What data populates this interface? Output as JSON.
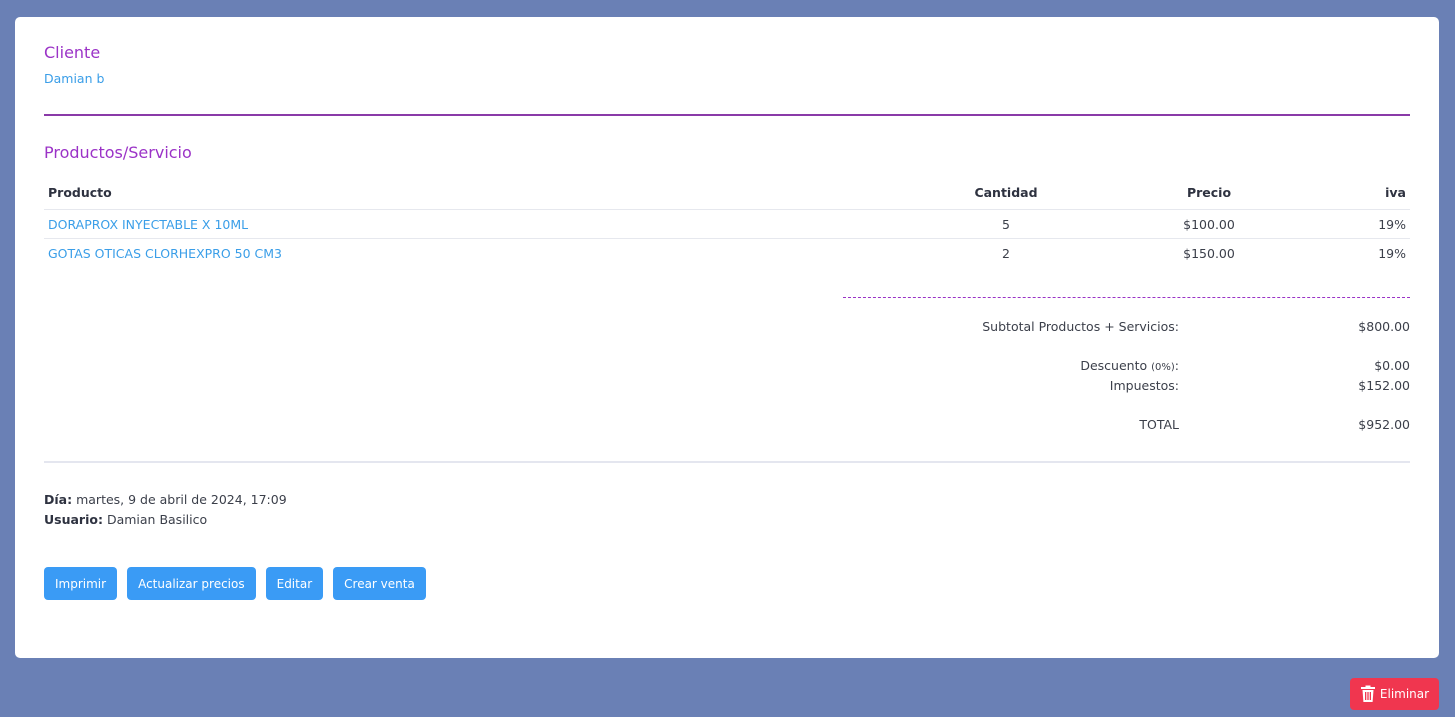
{
  "client": {
    "title": "Cliente",
    "name": "Damian b"
  },
  "products": {
    "title": "Productos/Servicio",
    "columns": [
      "Producto",
      "Cantidad",
      "Precio",
      "iva"
    ],
    "rows": [
      {
        "name": "DORAPROX INYECTABLE X 10ML",
        "qty": "5",
        "price": "$100.00",
        "iva": "19%"
      },
      {
        "name": "GOTAS OTICAS CLORHEXPRO 50 CM3",
        "qty": "2",
        "price": "$150.00",
        "iva": "19%"
      }
    ]
  },
  "summary": {
    "subtotal_label": "Subtotal Productos + Servicios:",
    "subtotal_value": "$800.00",
    "discount_label": "Descuento",
    "discount_pct": "(0%)",
    "discount_colon": ":",
    "discount_value": "$0.00",
    "taxes_label": "Impuestos:",
    "taxes_value": "$152.00",
    "total_label": "TOTAL",
    "total_value": "$952.00"
  },
  "meta": {
    "day_label": "Día:",
    "day_value": "martes, 9 de abril de 2024, 17:09",
    "user_label": "Usuario:",
    "user_value": "Damian Basilico"
  },
  "actions": {
    "print": "Imprimir",
    "update_prices": "Actualizar precios",
    "edit": "Editar",
    "create_sale": "Crear venta",
    "delete": "Eliminar"
  },
  "colors": {
    "background": "#6a80b5",
    "accent_purple": "#9b33c7",
    "link_blue": "#3a9ee8",
    "button_blue": "#3a9bf5",
    "danger_red": "#f0364f"
  },
  "icons": {
    "delete": "trash-icon"
  }
}
